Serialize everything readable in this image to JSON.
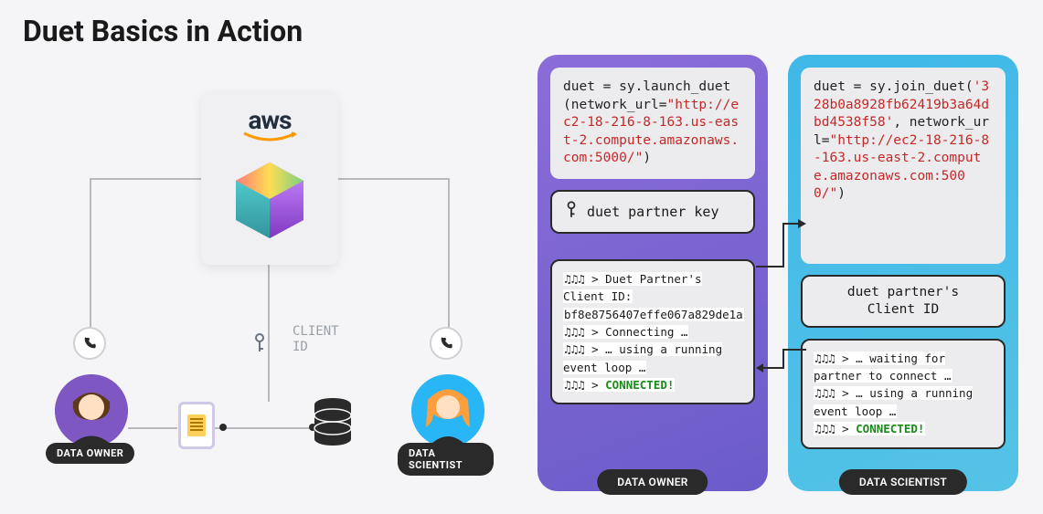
{
  "title": "Duet Basics in Action",
  "diagram": {
    "cloud_label": "aws",
    "client_id_label": "CLIENT ID",
    "roles": {
      "owner": "DATA OWNER",
      "scientist": "DATA SCIENTIST"
    }
  },
  "owner_panel": {
    "code_pre": "duet = sy.launch_duet(network_url=",
    "code_str": "\"http://ec2-18-216-8-163.us-east-2.compute.amazonaws.com:5000/\"",
    "code_post": ")",
    "key_label": "duet partner key",
    "log": {
      "l1": "♫♫♫ > Duet Partner's Client ID:",
      "l2": "bf8e8756407effe067a829de1a",
      "l3": "♫♫♫ > Connecting …",
      "l4": "♫♫♫ > … using a running event loop …",
      "l5_prefix": "♫♫♫ > ",
      "l5_ok": "CONNECTED!"
    },
    "pill": "DATA OWNER"
  },
  "scientist_panel": {
    "code_pre": "duet = sy.join_duet(",
    "code_str1": "'328b0a8928fb62419b3a64dbd4538f58'",
    "code_mid": ", network_url=",
    "code_str2": "\"http://ec2-18-216-8-163.us-east-2.compute.amazonaws.com:5000/\"",
    "code_post": ")",
    "client_bar_l1": "duet partner's",
    "client_bar_l2": "Client ID",
    "log": {
      "l1": "♫♫♫ > … waiting for partner to connect …",
      "l2": "♫♫♫ > … using a running event loop …",
      "l3_prefix": "♫♫♫ > ",
      "l3_ok": "CONNECTED!"
    },
    "pill": "DATA SCIENTIST"
  }
}
